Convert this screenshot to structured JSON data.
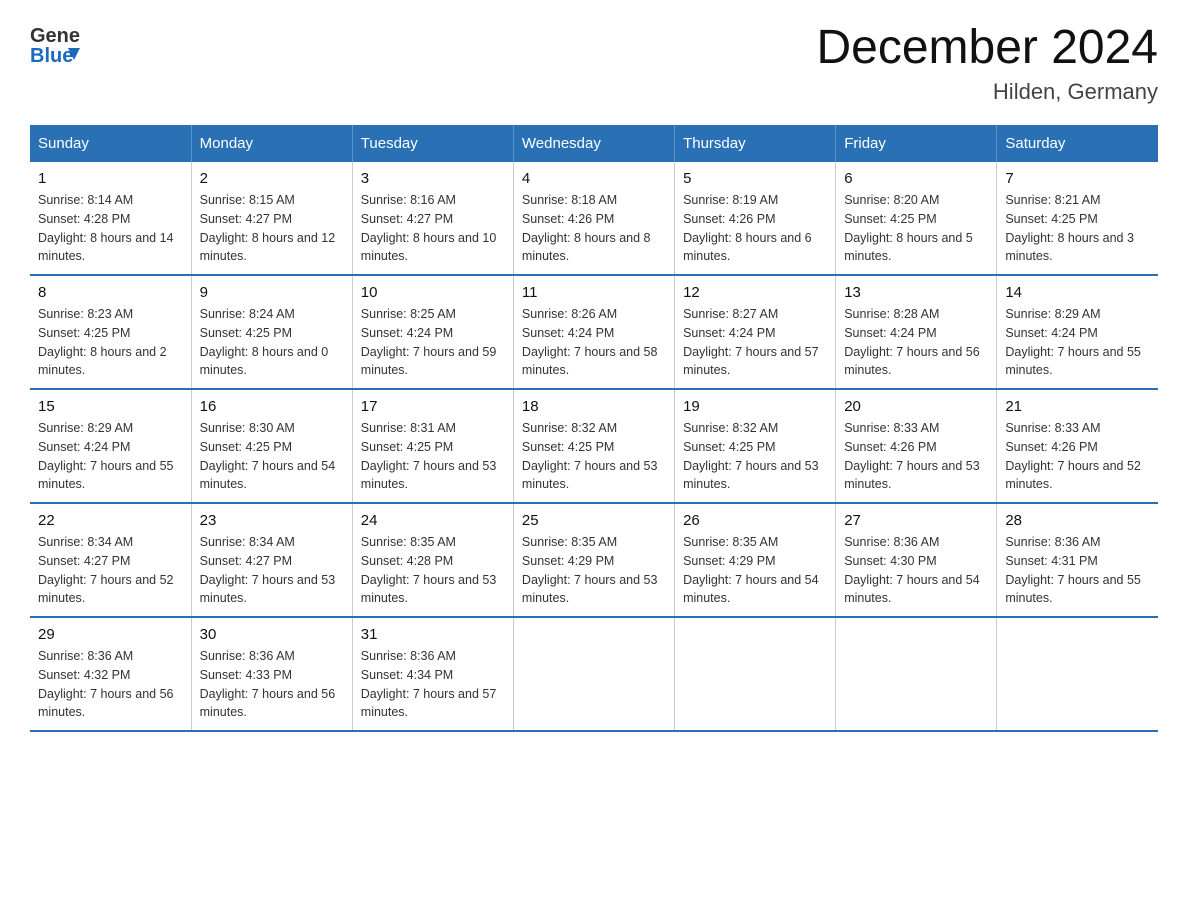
{
  "header": {
    "title": "December 2024",
    "subtitle": "Hilden, Germany"
  },
  "logo": {
    "general": "General",
    "blue": "Blue"
  },
  "weekdays": [
    "Sunday",
    "Monday",
    "Tuesday",
    "Wednesday",
    "Thursday",
    "Friday",
    "Saturday"
  ],
  "weeks": [
    [
      {
        "day": "1",
        "sunrise": "8:14 AM",
        "sunset": "4:28 PM",
        "daylight": "8 hours and 14 minutes."
      },
      {
        "day": "2",
        "sunrise": "8:15 AM",
        "sunset": "4:27 PM",
        "daylight": "8 hours and 12 minutes."
      },
      {
        "day": "3",
        "sunrise": "8:16 AM",
        "sunset": "4:27 PM",
        "daylight": "8 hours and 10 minutes."
      },
      {
        "day": "4",
        "sunrise": "8:18 AM",
        "sunset": "4:26 PM",
        "daylight": "8 hours and 8 minutes."
      },
      {
        "day": "5",
        "sunrise": "8:19 AM",
        "sunset": "4:26 PM",
        "daylight": "8 hours and 6 minutes."
      },
      {
        "day": "6",
        "sunrise": "8:20 AM",
        "sunset": "4:25 PM",
        "daylight": "8 hours and 5 minutes."
      },
      {
        "day": "7",
        "sunrise": "8:21 AM",
        "sunset": "4:25 PM",
        "daylight": "8 hours and 3 minutes."
      }
    ],
    [
      {
        "day": "8",
        "sunrise": "8:23 AM",
        "sunset": "4:25 PM",
        "daylight": "8 hours and 2 minutes."
      },
      {
        "day": "9",
        "sunrise": "8:24 AM",
        "sunset": "4:25 PM",
        "daylight": "8 hours and 0 minutes."
      },
      {
        "day": "10",
        "sunrise": "8:25 AM",
        "sunset": "4:24 PM",
        "daylight": "7 hours and 59 minutes."
      },
      {
        "day": "11",
        "sunrise": "8:26 AM",
        "sunset": "4:24 PM",
        "daylight": "7 hours and 58 minutes."
      },
      {
        "day": "12",
        "sunrise": "8:27 AM",
        "sunset": "4:24 PM",
        "daylight": "7 hours and 57 minutes."
      },
      {
        "day": "13",
        "sunrise": "8:28 AM",
        "sunset": "4:24 PM",
        "daylight": "7 hours and 56 minutes."
      },
      {
        "day": "14",
        "sunrise": "8:29 AM",
        "sunset": "4:24 PM",
        "daylight": "7 hours and 55 minutes."
      }
    ],
    [
      {
        "day": "15",
        "sunrise": "8:29 AM",
        "sunset": "4:24 PM",
        "daylight": "7 hours and 55 minutes."
      },
      {
        "day": "16",
        "sunrise": "8:30 AM",
        "sunset": "4:25 PM",
        "daylight": "7 hours and 54 minutes."
      },
      {
        "day": "17",
        "sunrise": "8:31 AM",
        "sunset": "4:25 PM",
        "daylight": "7 hours and 53 minutes."
      },
      {
        "day": "18",
        "sunrise": "8:32 AM",
        "sunset": "4:25 PM",
        "daylight": "7 hours and 53 minutes."
      },
      {
        "day": "19",
        "sunrise": "8:32 AM",
        "sunset": "4:25 PM",
        "daylight": "7 hours and 53 minutes."
      },
      {
        "day": "20",
        "sunrise": "8:33 AM",
        "sunset": "4:26 PM",
        "daylight": "7 hours and 53 minutes."
      },
      {
        "day": "21",
        "sunrise": "8:33 AM",
        "sunset": "4:26 PM",
        "daylight": "7 hours and 52 minutes."
      }
    ],
    [
      {
        "day": "22",
        "sunrise": "8:34 AM",
        "sunset": "4:27 PM",
        "daylight": "7 hours and 52 minutes."
      },
      {
        "day": "23",
        "sunrise": "8:34 AM",
        "sunset": "4:27 PM",
        "daylight": "7 hours and 53 minutes."
      },
      {
        "day": "24",
        "sunrise": "8:35 AM",
        "sunset": "4:28 PM",
        "daylight": "7 hours and 53 minutes."
      },
      {
        "day": "25",
        "sunrise": "8:35 AM",
        "sunset": "4:29 PM",
        "daylight": "7 hours and 53 minutes."
      },
      {
        "day": "26",
        "sunrise": "8:35 AM",
        "sunset": "4:29 PM",
        "daylight": "7 hours and 54 minutes."
      },
      {
        "day": "27",
        "sunrise": "8:36 AM",
        "sunset": "4:30 PM",
        "daylight": "7 hours and 54 minutes."
      },
      {
        "day": "28",
        "sunrise": "8:36 AM",
        "sunset": "4:31 PM",
        "daylight": "7 hours and 55 minutes."
      }
    ],
    [
      {
        "day": "29",
        "sunrise": "8:36 AM",
        "sunset": "4:32 PM",
        "daylight": "7 hours and 56 minutes."
      },
      {
        "day": "30",
        "sunrise": "8:36 AM",
        "sunset": "4:33 PM",
        "daylight": "7 hours and 56 minutes."
      },
      {
        "day": "31",
        "sunrise": "8:36 AM",
        "sunset": "4:34 PM",
        "daylight": "7 hours and 57 minutes."
      },
      null,
      null,
      null,
      null
    ]
  ]
}
